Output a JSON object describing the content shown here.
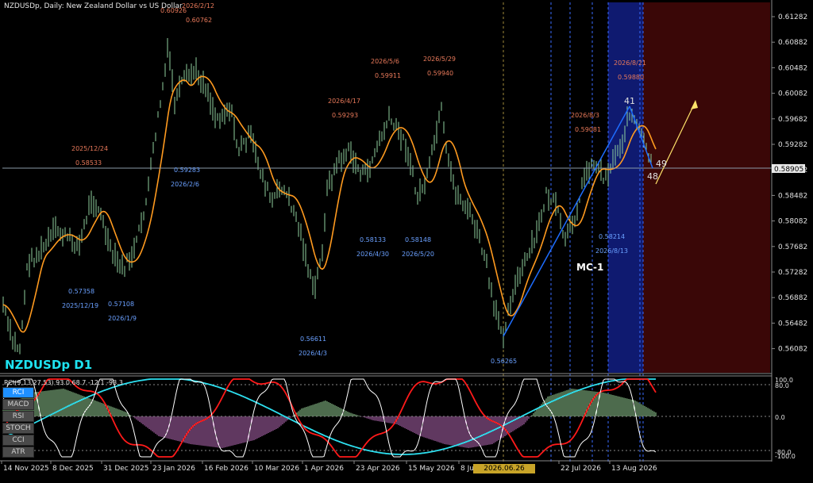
{
  "window": {
    "title": "NZDUSDp, Daily:  New Zealand Dollar vs US Dollar",
    "symbol_label": "NZDUSDp D1"
  },
  "colors": {
    "price_bars": "#8fd19e",
    "moving_average": "#ff9a1f",
    "rci_fast": "#ffffff",
    "rci_mid": "#ff1a1a",
    "rci_slow": "#2de0f0",
    "histogram": "#9ad69a",
    "histogram_neg": "#c070c0",
    "highlight_zone": "#0f1a70",
    "future_zone": "#3a0707",
    "swing_high": "#e8795a",
    "swing_low": "#6aa0ff",
    "date_badge": "#c8a428"
  },
  "price_axis": {
    "ticks": [
      "0.61282",
      "0.60882",
      "0.60482",
      "0.60082",
      "0.59682",
      "0.59282",
      "0.58882",
      "0.58482",
      "0.58082",
      "0.57682",
      "0.57282",
      "0.56882",
      "0.56482",
      "0.56082"
    ],
    "current_price": "0.58905"
  },
  "time_axis": {
    "labels": [
      "14 Nov 2025",
      "8 Dec 2025",
      "31 Dec 2025",
      "23 Jan 2026",
      "16 Feb 2026",
      "10 Mar 2026",
      "1 Apr 2026",
      "23 Apr 2026",
      "15 May 2026",
      "8 Ju",
      "22 Jul 2026",
      "13 Aug 2026"
    ],
    "cursor_date": "2026.06.26 00:00"
  },
  "annotations": {
    "highs": [
      {
        "date": "2026/2/12",
        "price": "0.60762"
      },
      {
        "date": "",
        "price": "0.60926"
      },
      {
        "date": "2025/12/24",
        "price": "0.58533"
      },
      {
        "date": "2026/4/17",
        "price": "0.59293"
      },
      {
        "date": "2026/5/6",
        "price": "0.59911"
      },
      {
        "date": "2026/5/29",
        "price": "0.59940"
      },
      {
        "date": "2026/8/3",
        "price": "0.59081"
      },
      {
        "date": "2026/8/21",
        "price": "0.59880"
      }
    ],
    "lows": [
      {
        "date": "2025/12/19",
        "price": "0.57358"
      },
      {
        "date": "2026/1/9",
        "price": "0.57108"
      },
      {
        "date": "2026/2/6",
        "price": "0.59283"
      },
      {
        "date": "2026/4/3",
        "price": "0.56611"
      },
      {
        "date": "2026/4/30",
        "price": "0.58133"
      },
      {
        "date": "2026/5/20",
        "price": "0.58148"
      },
      {
        "date": "",
        "price": "0.56265"
      },
      {
        "date": "2026/8/13",
        "price": "0.58214"
      }
    ],
    "wave_labels": {
      "top": "41",
      "right": "49",
      "bottom": "48",
      "pattern": "MC-1"
    }
  },
  "indicator": {
    "header": "RCI(9,13,27,53) 93.0 68.7 -12.1 -93.3",
    "buttons": [
      {
        "label": "RCI",
        "active": true
      },
      {
        "label": "MACD",
        "active": false
      },
      {
        "label": "RSI",
        "active": false
      },
      {
        "label": "STOCH",
        "active": false
      },
      {
        "label": "CCI",
        "active": false
      },
      {
        "label": "ATR",
        "active": false
      }
    ],
    "scale": [
      "100.0",
      "80.0",
      "0.0",
      "-80.0",
      "-100.0"
    ]
  }
}
